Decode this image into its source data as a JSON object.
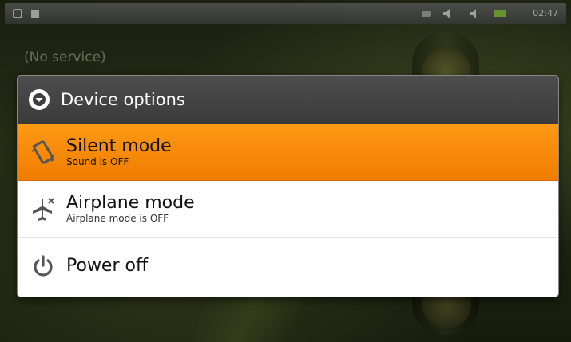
{
  "status_bar": {
    "time": "02:47",
    "icons": [
      "usb-icon",
      "notification-icon",
      "signal-icon",
      "volume-icon",
      "volume-icon",
      "battery-icon"
    ]
  },
  "carrier_text": "(No service)",
  "dialog": {
    "title": "Device options",
    "title_icon": "dropdown-circle-icon",
    "items": [
      {
        "title": "Silent mode",
        "subtitle": "Sound is OFF",
        "icon": "vibrate-phone-icon",
        "selected": true
      },
      {
        "title": "Airplane mode",
        "subtitle": "Airplane mode is OFF",
        "icon": "airplane-icon",
        "selected": false
      },
      {
        "title": "Power off",
        "subtitle": "",
        "icon": "power-icon",
        "selected": false
      }
    ]
  },
  "colors": {
    "selected_item": "#f08a00",
    "header_bg": "#444444",
    "dialog_bg": "#ffffff"
  }
}
